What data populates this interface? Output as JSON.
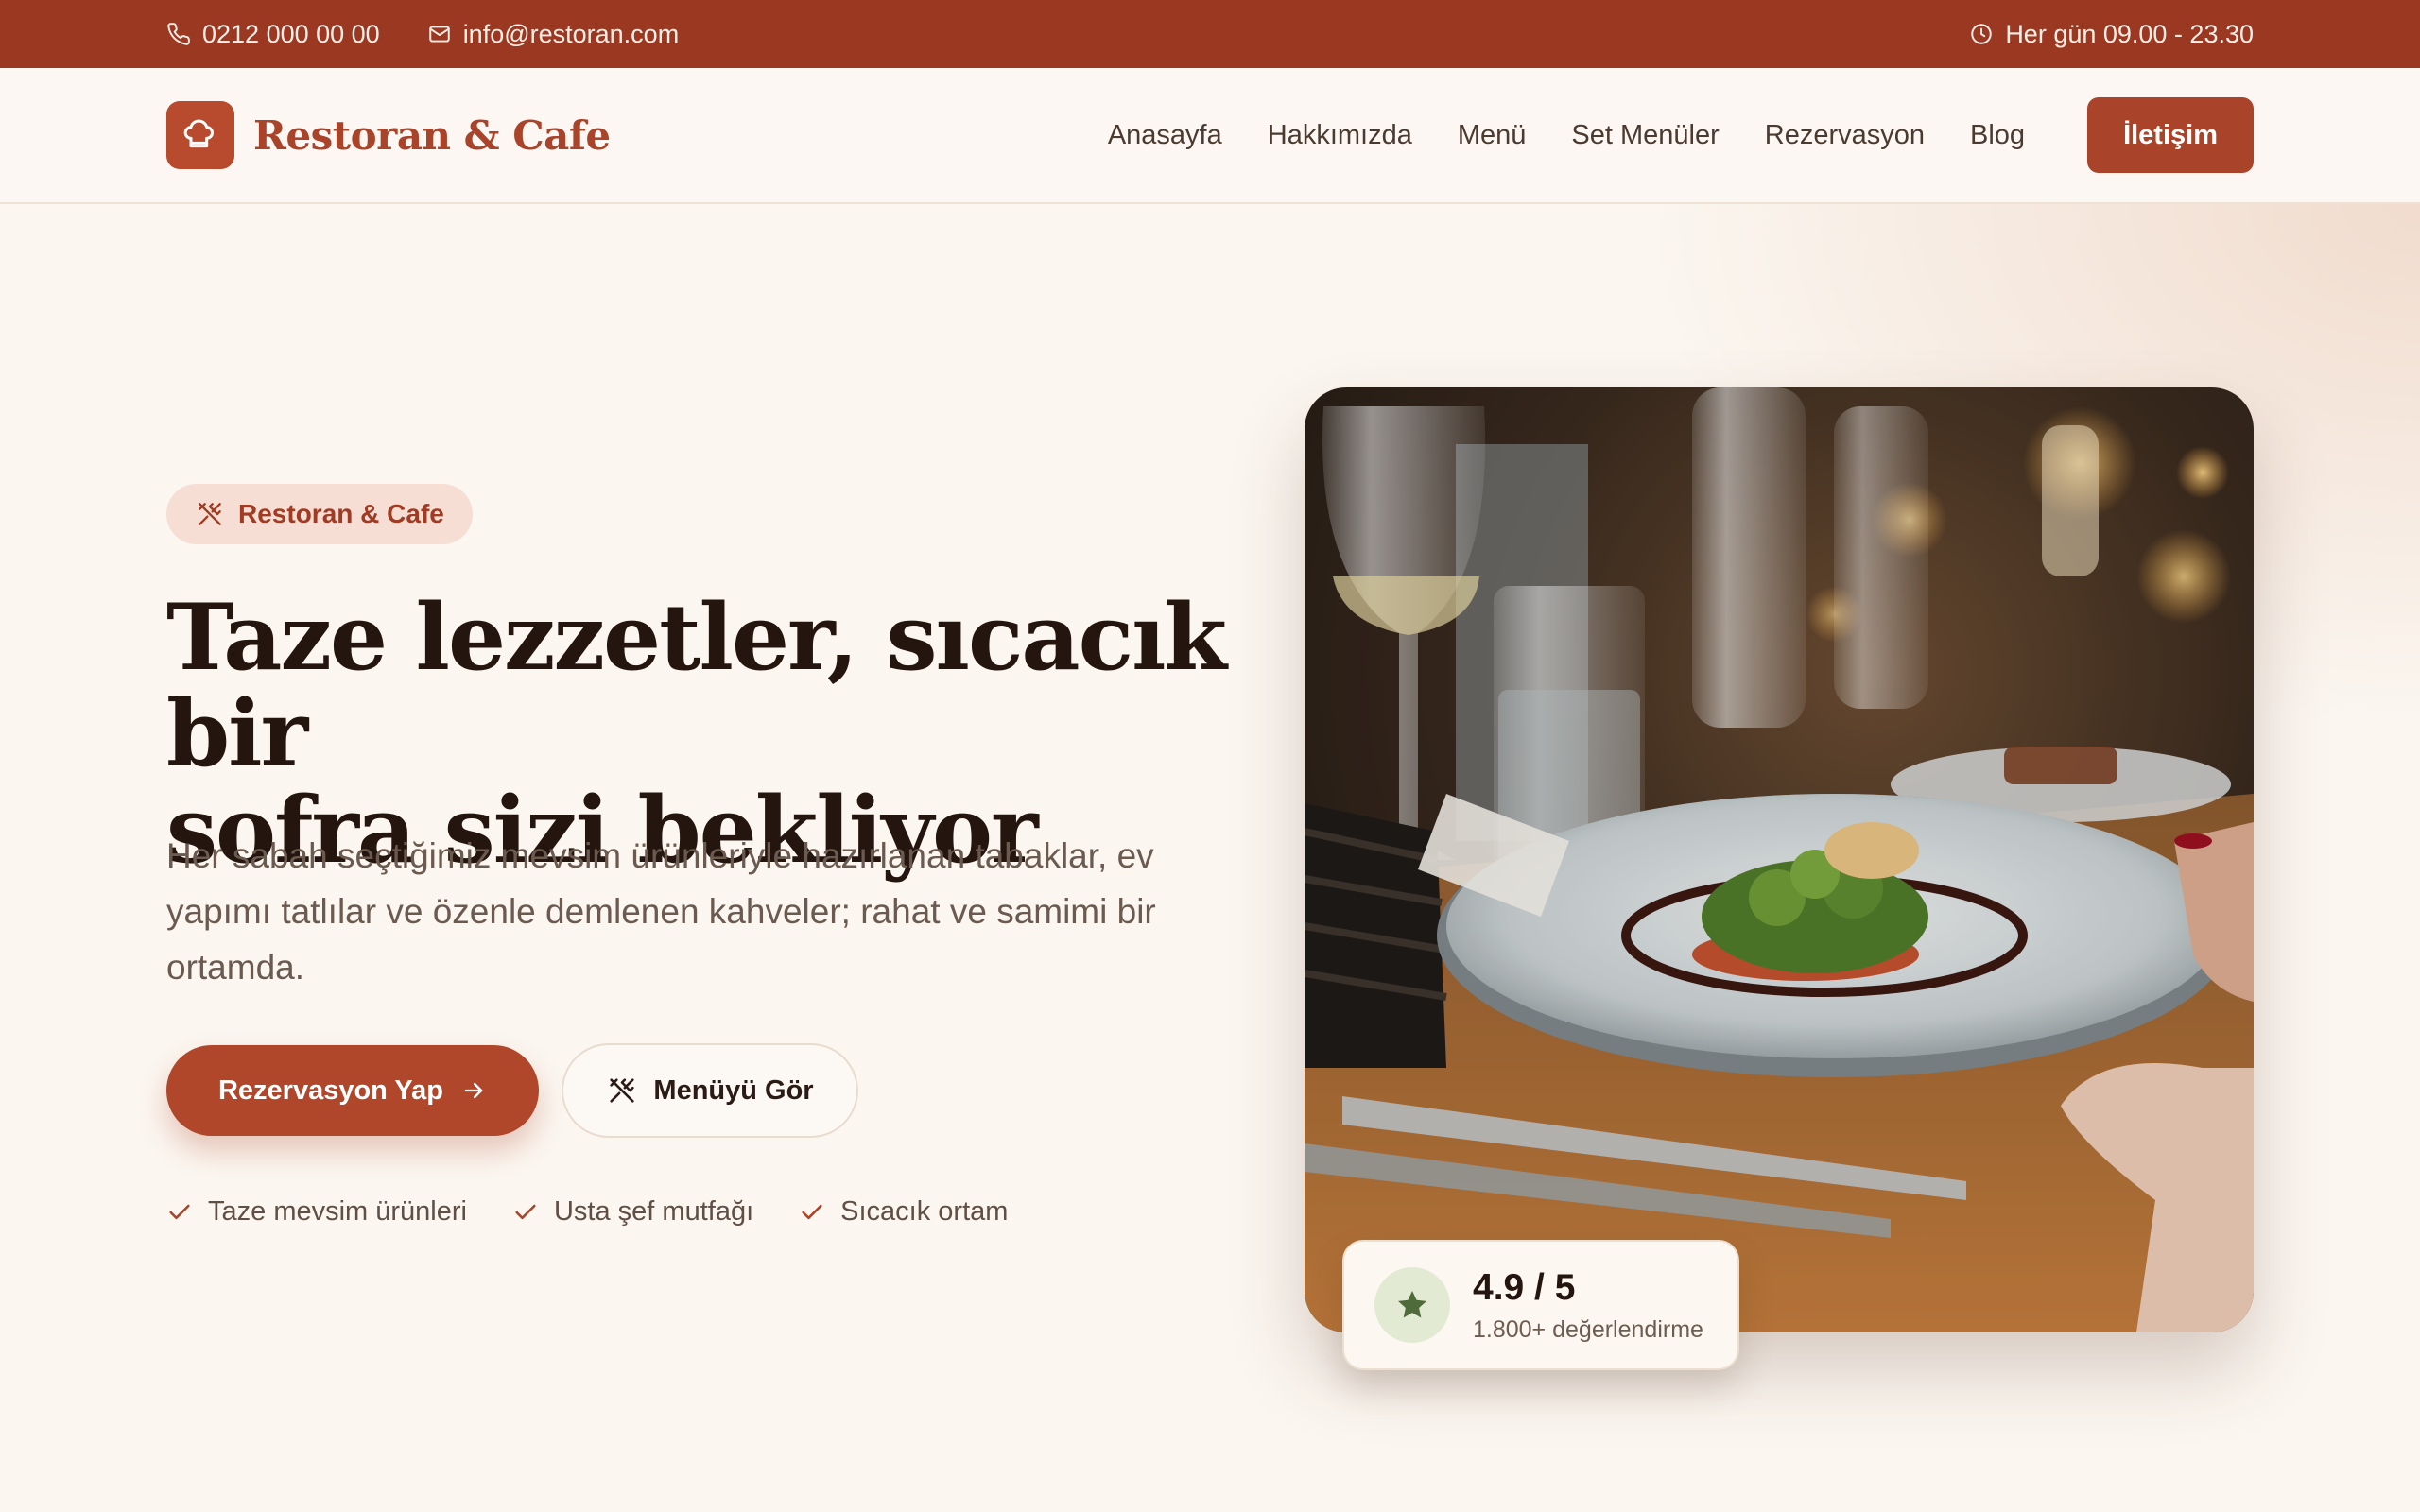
{
  "topbar": {
    "phone": "0212 000 00 00",
    "email": "info@restoran.com",
    "hours": "Her gün 09.00 - 23.30"
  },
  "header": {
    "brand": "Restoran & Cafe",
    "nav": [
      "Anasayfa",
      "Hakkımızda",
      "Menü",
      "Set Menüler",
      "Rezervasyon",
      "Blog"
    ],
    "cta": "İletişim"
  },
  "hero": {
    "badge": "Restoran & Cafe",
    "title_line1": "Taze lezzetler, sıcacık bir",
    "title_line2": "sofra sizi bekliyor",
    "text": "Her sabah seçtiğimiz mevsim ürünleriyle hazırlanan tabaklar, ev yapımı tatlılar ve özenle demlenen kahveler; rahat ve samimi bir ortamda.",
    "primary_button": "Rezervasyon Yap",
    "secondary_button": "Menüyü Gör",
    "features": [
      "Taze mevsim ürünleri",
      "Usta şef mutfağı",
      "Sıcacık ortam"
    ]
  },
  "rating": {
    "score": "4.9 / 5",
    "count": "1.800+ değerlendirme"
  },
  "icons": {
    "phone": "phone-icon",
    "email": "mail-icon",
    "clock": "clock-icon",
    "logo": "chef-hat-icon",
    "badge": "utensils-icon",
    "arrow": "arrow-right-icon",
    "check": "check-icon",
    "star": "star-icon"
  },
  "colors": {
    "brand": "#a9442a",
    "topbar": "#9b3822",
    "background": "#fbf6f0",
    "badge_bg": "#f6ded4",
    "rating_circle": "#e3ead4",
    "star": "#4f6b3a"
  }
}
